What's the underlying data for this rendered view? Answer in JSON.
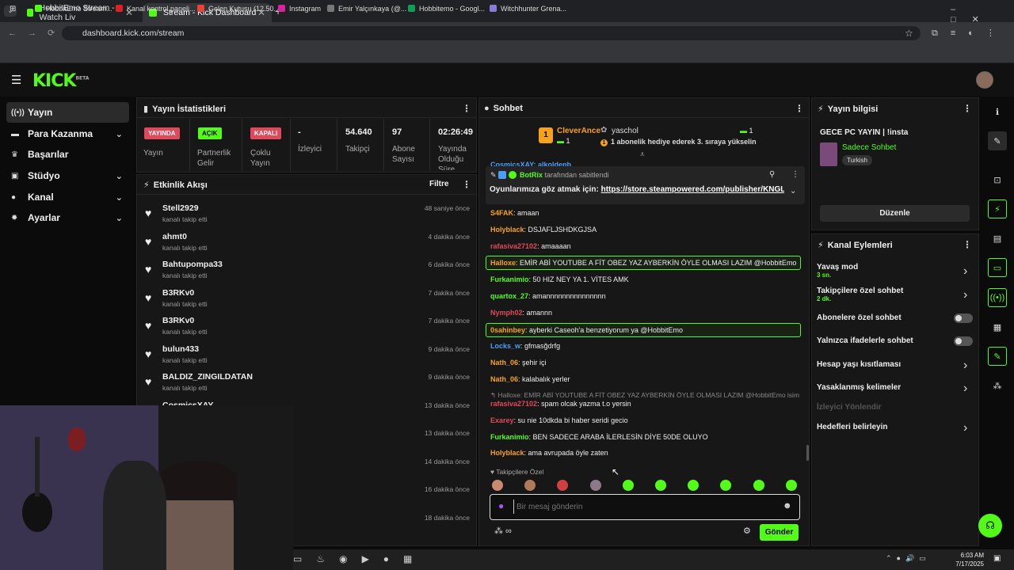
{
  "browser": {
    "tabs": [
      {
        "title": "HobbitEmo Stream - Watch Liv"
      },
      {
        "title": "Stream - Kick Dashboard"
      }
    ],
    "url": "dashboard.kick.com/stream",
    "bookmarks": [
      "HobbitEmo Stream...",
      "Kanal kontrol paneli...",
      "Gelen Kutusu (12.50...",
      "Instagram",
      "Emir Yalçınkaya (@...",
      "Hobbitemo - Googl...",
      "Witchhunter Grena..."
    ]
  },
  "app": {
    "logo": "KICK",
    "beta": "BETA"
  },
  "sidebar": [
    {
      "label": "Yayın",
      "icon": "broadcast-icon"
    },
    {
      "label": "Para Kazanma",
      "icon": "money-icon"
    },
    {
      "label": "Başarılar",
      "icon": "trophy-icon"
    },
    {
      "label": "Stüdyo",
      "icon": "camera-icon"
    },
    {
      "label": "Kanal",
      "icon": "user-icon"
    },
    {
      "label": "Ayarlar",
      "icon": "gear-icon"
    }
  ],
  "stats": {
    "title": "Yayın İstatistikleri",
    "badges": [
      {
        "text": "YAYINDA",
        "label": "Yayın"
      },
      {
        "text": "AÇIK",
        "label": "Partnerlik Gelir"
      },
      {
        "text": "KAPALI",
        "label": "Çoklu Yayın"
      }
    ],
    "values": [
      {
        "v": "-",
        "l": "İzleyici"
      },
      {
        "v": "54.640",
        "l": "Takipçi"
      },
      {
        "v": "97",
        "l": "Abone Sayısı"
      },
      {
        "v": "02:26:49",
        "l": "Yayında Olduğu Süre"
      }
    ]
  },
  "activity": {
    "title": "Etkinlik Akışı",
    "filter": "Filtre",
    "sub": "kanalı takip etti",
    "items": [
      {
        "name": "Stell2929",
        "time": "48 saniye önce"
      },
      {
        "name": "ahmt0",
        "time": "4 dakika önce"
      },
      {
        "name": "Bahtupompa33",
        "time": "6 dakika önce"
      },
      {
        "name": "B3RKv0",
        "time": "7 dakika önce"
      },
      {
        "name": "B3RKv0",
        "time": "7 dakika önce"
      },
      {
        "name": "bulun433",
        "time": "9 dakika önce"
      },
      {
        "name": "BALDIZ_ZINGILDATAN",
        "time": "9 dakika önce"
      },
      {
        "name": "CosmicsXAY",
        "time": "13 dakika önce"
      },
      {
        "name": "",
        "time": "13 dakika önce"
      },
      {
        "name": "",
        "time": "14 dakika önce"
      },
      {
        "name": "",
        "time": "16 dakika önce"
      },
      {
        "name": "",
        "time": "18 dakika önce"
      }
    ]
  },
  "chat": {
    "title": "Sohbet",
    "gift": {
      "rank": "1",
      "user": "CleverAnce",
      "count": "1",
      "giver": "yaschol",
      "giver_count": "1",
      "text": "1 abonelik hediye ederek 3. sıraya yükselin"
    },
    "partial": "CosmicsXAY: alkoldenb",
    "pinned": {
      "by": "BotRix",
      "by_suffix": "tarafından sabitlendi",
      "text": "Oyunlarımıza göz atmak için:",
      "link": "https://store.steampowered.com/publisher/KNGL"
    },
    "messages": [
      {
        "user": "S4FAK",
        "color": "#f7a21b",
        "text": "amaan"
      },
      {
        "user": "Holyblack",
        "color": "#f7a21b",
        "text": "DSJAFLJSHDKGJSA"
      },
      {
        "user": "rafasiva27102",
        "color": "#e0495b",
        "text": "amaaaan"
      },
      {
        "user": "Halloxe",
        "color": "#f7a21b",
        "text": "EMİR ABİ YOUTUBE A FİT OBEZ YAZ AYBERKİN ÖYLE OLMASI LAZIM @HobbitEmo"
      },
      {
        "user": "Furkanimio",
        "color": "#53fc18",
        "text": "50 HIZ NEY YA 1. VİTES AMK"
      },
      {
        "user": "quartox_27",
        "color": "#53fc18",
        "text": "amannnnnnnnnnnnnnn"
      },
      {
        "user": "Nymph02",
        "color": "#e0495b",
        "text": "amannn"
      },
      {
        "user": "0sahinbey",
        "color": "#f7a21b",
        "text": "ayberki Caseoh'a benzetiyorum ya @HobbitEmo"
      },
      {
        "user": "Locks_w",
        "color": "#4a9ff5",
        "text": "gfmasğdrfg"
      },
      {
        "user": "Nath_06",
        "color": "#f7a21b",
        "text": "şehir içi"
      },
      {
        "user": "Nath_06",
        "color": "#f7a21b",
        "text": "kalabalık yerler"
      },
      {
        "user": "rafasiva27102",
        "color": "#e0495b",
        "text": "spam olcak yazma t.o yersin"
      },
      {
        "user": "Exarey",
        "color": "#e0495b",
        "text": "su nie 10dkda bi haber seridi gecio"
      },
      {
        "user": "Furkanimio",
        "color": "#53fc18",
        "text": "BEN SADECE ARABA İLERLESİN DİYE 50DE OLUYO"
      },
      {
        "user": "Holyblack",
        "color": "#f7a21b",
        "text": "ama avrupada öyle zaten"
      }
    ],
    "reply": "↰ Halloxe: EMİR ABİ YOUTUBE A FİT OBEZ YAZ AYBERKİN ÖYLE OLMASI LAZIM @HobbitEmo isimi...",
    "followers_only": "Takipçilere Özel",
    "placeholder": "Bir mesaj gönderin",
    "send": "Gönder"
  },
  "info": {
    "title": "Yayın bilgisi",
    "stream_title": "GECE PC YAYIN | !insta",
    "category": "Sadece Sohbet",
    "tag": "Turkish",
    "edit": "Düzenle"
  },
  "actions": {
    "title": "Kanal Eylemleri",
    "items": [
      {
        "label": "Yavaş mod",
        "sub": "3 sn.",
        "type": "chev"
      },
      {
        "label": "Takipçilere özel sohbet",
        "sub": "2 dk.",
        "type": "chev"
      },
      {
        "label": "Abonelere özel sohbet",
        "sub": "",
        "type": "toggle"
      },
      {
        "label": "Yalnızca ifadelerle sohbet",
        "sub": "",
        "type": "toggle"
      },
      {
        "label": "Hesap yaşı kısıtlaması",
        "sub": "",
        "type": "chev"
      },
      {
        "label": "Yasaklanmış kelimeler",
        "sub": "",
        "type": "chev"
      },
      {
        "label": "İzleyici Yönlendir",
        "sub": "",
        "type": "disabled"
      },
      {
        "label": "Hedefleri belirleyin",
        "sub": "",
        "type": "chev"
      }
    ]
  },
  "taskbar": {
    "time": "6:03 AM",
    "date": "7/17/2025"
  },
  "colors": {
    "accent": "#53fc18",
    "live": "#e0495b"
  }
}
